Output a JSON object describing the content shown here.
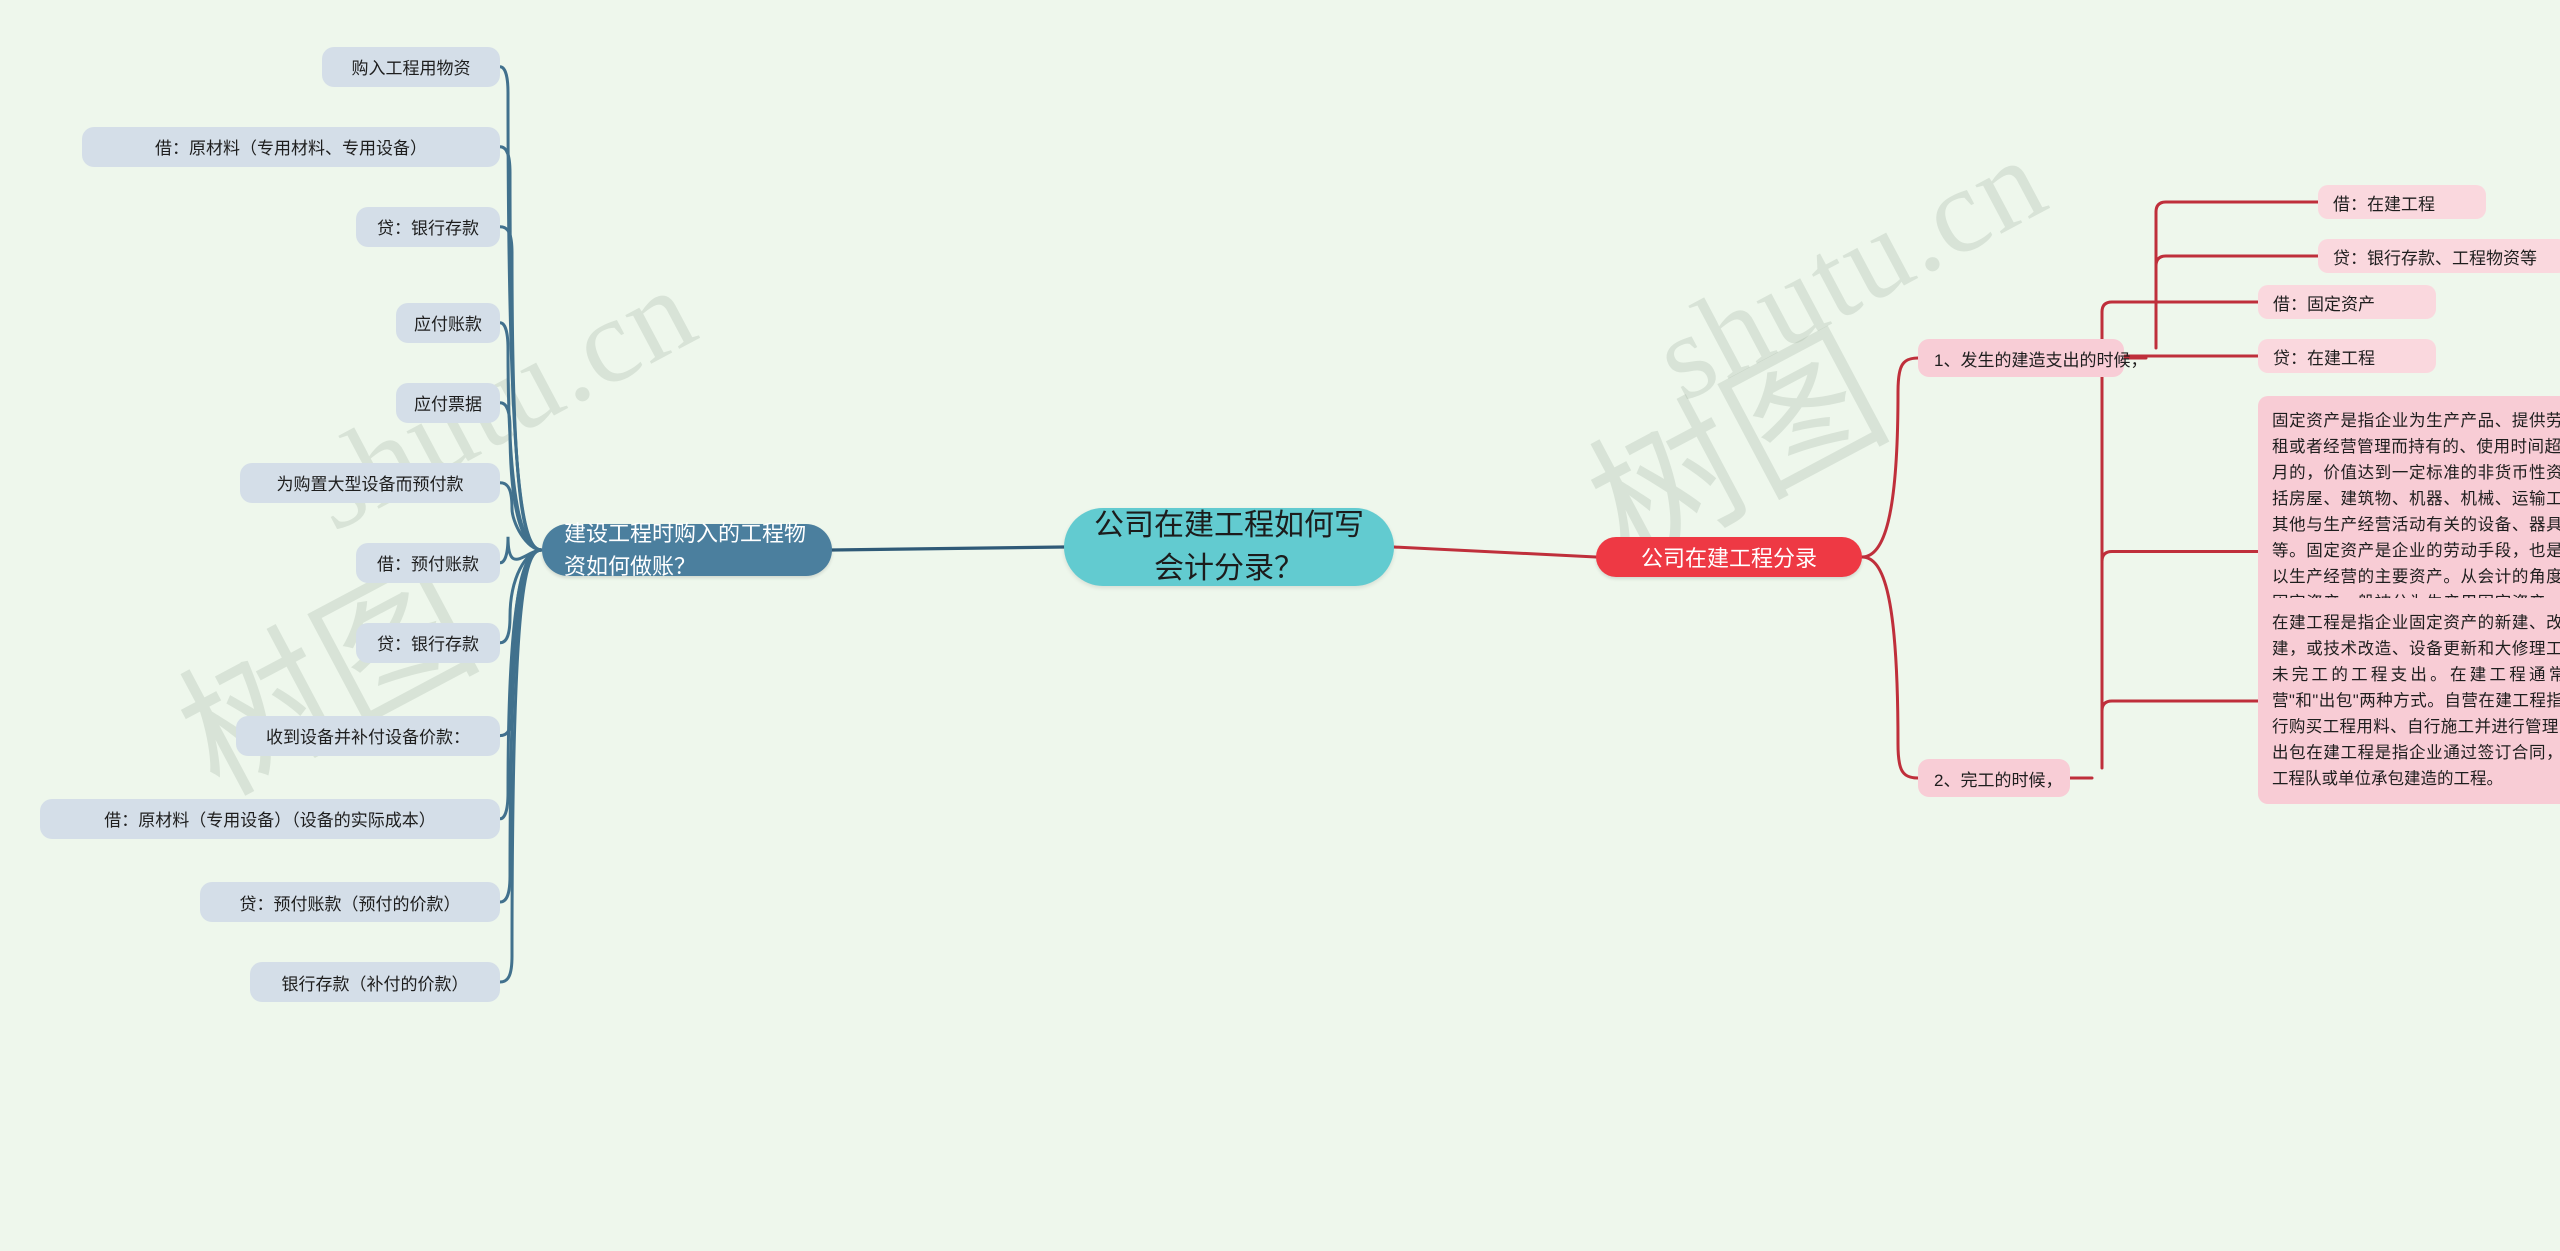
{
  "canvas": {
    "background_color": "#eef7ec",
    "watermark_texts": [
      "shutu.cn",
      "shutu.cn",
      "树图",
      "树图"
    ]
  },
  "root": {
    "label": "公司在建工程如何写会计分录？",
    "color": "#62cbd0"
  },
  "left_branch": {
    "label": "建设工程时购入的工程物资如何做账？",
    "color": "#4b7f9e",
    "leaves": [
      {
        "label": "购入工程用物资"
      },
      {
        "label": "借：原材料（专用材料、专用设备）"
      },
      {
        "label": "贷：银行存款"
      },
      {
        "label": "应付账款"
      },
      {
        "label": "应付票据"
      },
      {
        "label": "为购置大型设备而预付款"
      },
      {
        "label": "借：预付账款"
      },
      {
        "label": "贷：银行存款"
      },
      {
        "label": "收到设备并补付设备价款："
      },
      {
        "label": "借：原材料（专用设备）（设备的实际成本）"
      },
      {
        "label": "贷：预付账款（预付的价款）"
      },
      {
        "label": "银行存款（补付的价款）"
      }
    ]
  },
  "right_branch": {
    "label": "公司在建工程分录",
    "color": "#ee3944",
    "groups": [
      {
        "label": "1、发生的建造支出的时候，",
        "children": [
          {
            "label": "借：在建工程"
          },
          {
            "label": "贷：银行存款、工程物资等"
          }
        ]
      },
      {
        "label": "2、完工的时候，",
        "children": [
          {
            "label": "借：固定资产"
          },
          {
            "label": "贷：在建工程"
          },
          {
            "label": "固定资产是指企业为生产产品、提供劳务、出租或者经营管理而持有的、使用时间超过12个月的，价值达到一定标准的非货币性资产，包括房屋、建筑物、机器、机械、运输工具以及其他与生产经营活动有关的设备、器具、工具等。固定资产是企业的劳动手段，也是企业赖以生产经营的主要资产。从会计的角度划分，固定资产一般被分为生产用固定资产、非生产用固定资产、租出固定资产、未使用固定资产、不需用固定资产、融资租赁固定资产、接受捐赠固定资产等。"
          },
          {
            "label": "在建工程是指企业固定资产的新建、改建、扩建，或技术改造、设备更新和大修理工程等尚未完工的工程支出。在建工程通常有\"自营\"和\"出包\"两种方式。自营在建工程指企业自行购买工程用料、自行施工并进行管理的工程;出包在建工程是指企业通过签订合同，由其它工程队或单位承包建造的工程。"
          }
        ]
      }
    ]
  }
}
